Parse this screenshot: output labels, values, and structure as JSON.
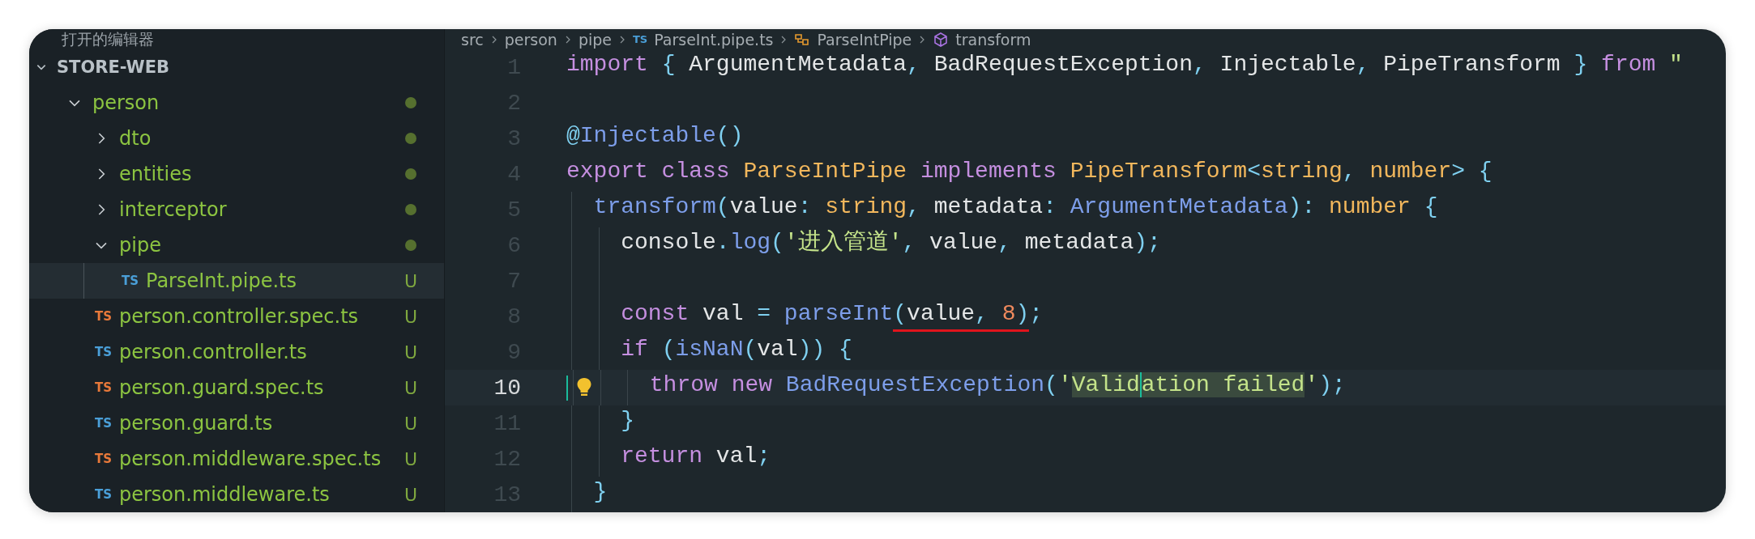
{
  "explorer": {
    "open_editors_title": "打开的编辑器",
    "root": {
      "title": "STORE-WEB"
    },
    "tree": [
      {
        "name": "person",
        "kind": "folder",
        "expanded": true,
        "selected": false,
        "modified_dot": true,
        "children": [
          {
            "name": "dto",
            "kind": "folder",
            "expanded": false,
            "selected": false,
            "modified_dot": true
          },
          {
            "name": "entities",
            "kind": "folder",
            "expanded": false,
            "selected": false,
            "modified_dot": true
          },
          {
            "name": "interceptor",
            "kind": "folder",
            "expanded": false,
            "selected": false,
            "modified_dot": true
          },
          {
            "name": "pipe",
            "kind": "folder",
            "expanded": true,
            "selected": false,
            "modified_dot": true,
            "children": [
              {
                "name": "ParseInt.pipe.ts",
                "kind": "file",
                "badge": "TS",
                "color": "#4a9fd8",
                "status": "U",
                "selected": true
              }
            ]
          },
          {
            "name": "person.controller.spec.ts",
            "kind": "file",
            "badge": "TS",
            "color": "#e8793a",
            "status": "U",
            "selected": false
          },
          {
            "name": "person.controller.ts",
            "kind": "file",
            "badge": "TS",
            "color": "#4a9fd8",
            "status": "U",
            "selected": false
          },
          {
            "name": "person.guard.spec.ts",
            "kind": "file",
            "badge": "TS",
            "color": "#e8793a",
            "status": "U",
            "selected": false
          },
          {
            "name": "person.guard.ts",
            "kind": "file",
            "badge": "TS",
            "color": "#4a9fd8",
            "status": "U",
            "selected": false
          },
          {
            "name": "person.middleware.spec.ts",
            "kind": "file",
            "badge": "TS",
            "color": "#e8793a",
            "status": "U",
            "selected": false
          },
          {
            "name": "person.middleware.ts",
            "kind": "file",
            "badge": "TS",
            "color": "#4a9fd8",
            "status": "U",
            "selected": false
          }
        ]
      }
    ]
  },
  "breadcrumb": [
    {
      "kind": "folder",
      "text": "src"
    },
    {
      "kind": "folder",
      "text": "person"
    },
    {
      "kind": "folder",
      "text": "pipe"
    },
    {
      "kind": "file",
      "badge": "TS",
      "text": "ParseInt.pipe.ts"
    },
    {
      "kind": "class",
      "text": "ParseIntPipe"
    },
    {
      "kind": "method",
      "text": "transform"
    }
  ],
  "code": [
    {
      "number": "1",
      "current": false,
      "lightbulb": false,
      "tokens": [
        {
          "kind": "kw",
          "text": "import "
        },
        {
          "kind": "punct",
          "text": "{"
        },
        {
          "kind": "plain",
          "text": " ArgumentMetadata"
        },
        {
          "kind": "punct",
          "text": ","
        },
        {
          "kind": "plain",
          "text": " BadRequestException"
        },
        {
          "kind": "punct",
          "text": ","
        },
        {
          "kind": "plain",
          "text": " Injectable"
        },
        {
          "kind": "punct",
          "text": ","
        },
        {
          "kind": "plain",
          "text": " PipeTransform "
        },
        {
          "kind": "punct",
          "text": "} "
        },
        {
          "kind": "kw",
          "text": "from "
        },
        {
          "kind": "str",
          "text": "\""
        }
      ]
    },
    {
      "number": "2",
      "current": false,
      "lightbulb": false
    },
    {
      "number": "3",
      "current": false,
      "lightbulb": false,
      "tokens": [
        {
          "kind": "punct",
          "text": "@"
        },
        {
          "kind": "fn",
          "text": "Injectable"
        },
        {
          "kind": "punct",
          "text": "()"
        }
      ]
    },
    {
      "number": "4",
      "current": false,
      "lightbulb": false,
      "tokens": [
        {
          "kind": "kw",
          "text": "export class "
        },
        {
          "kind": "type",
          "text": "ParseIntPipe "
        },
        {
          "kind": "kw",
          "text": "implements "
        },
        {
          "kind": "type",
          "text": "PipeTransform"
        },
        {
          "kind": "punct",
          "text": "<"
        },
        {
          "kind": "type",
          "text": "string"
        },
        {
          "kind": "punct",
          "text": ", "
        },
        {
          "kind": "type",
          "text": "number"
        },
        {
          "kind": "punct",
          "text": "> {"
        }
      ]
    },
    {
      "number": "5",
      "current": false,
      "lightbulb": false,
      "tokens": [
        {
          "kind": "fn",
          "text": "  transform"
        },
        {
          "kind": "punct",
          "text": "("
        },
        {
          "kind": "plain",
          "text": "value"
        },
        {
          "kind": "punct",
          "text": ": "
        },
        {
          "kind": "type",
          "text": "string"
        },
        {
          "kind": "punct",
          "text": ","
        },
        {
          "kind": "plain",
          "text": " metadata"
        },
        {
          "kind": "punct",
          "text": ": "
        },
        {
          "kind": "fn",
          "text": "ArgumentMetadata"
        },
        {
          "kind": "punct",
          "text": "): "
        },
        {
          "kind": "type",
          "text": "number "
        },
        {
          "kind": "punct",
          "text": "{"
        }
      ]
    },
    {
      "number": "6",
      "current": false,
      "lightbulb": false,
      "tokens": [
        {
          "kind": "plain",
          "text": "    console"
        },
        {
          "kind": "punct",
          "text": "."
        },
        {
          "kind": "fn",
          "text": "log"
        },
        {
          "kind": "punct",
          "text": "("
        },
        {
          "kind": "str",
          "text": "'进入管道'"
        },
        {
          "kind": "punct",
          "text": ","
        },
        {
          "kind": "plain",
          "text": " value"
        },
        {
          "kind": "punct",
          "text": ","
        },
        {
          "kind": "plain",
          "text": " metadata"
        },
        {
          "kind": "punct",
          "text": ");"
        }
      ]
    },
    {
      "number": "7",
      "current": false,
      "lightbulb": false
    },
    {
      "number": "8",
      "current": false,
      "lightbulb": false,
      "tokens": [
        {
          "kind": "kw",
          "text": "    const"
        },
        {
          "kind": "plain",
          "text": " val "
        },
        {
          "kind": "punct",
          "text": "= "
        },
        {
          "kind": "fn",
          "text": "parseInt"
        },
        {
          "kind": "punct",
          "text": "(",
          "underlined": true
        },
        {
          "kind": "plain",
          "text": "value",
          "underlined": true
        },
        {
          "kind": "punct",
          "text": ", ",
          "underlined": true
        },
        {
          "kind": "num",
          "text": "8",
          "underlined": true
        },
        {
          "kind": "punct",
          "text": ")",
          "underlined": true
        },
        {
          "kind": "punct",
          "text": ";",
          "underlined": false
        }
      ]
    },
    {
      "number": "9",
      "current": false,
      "lightbulb": false,
      "tokens": [
        {
          "kind": "kw",
          "text": "    if "
        },
        {
          "kind": "punct",
          "text": "("
        },
        {
          "kind": "fn",
          "text": "isNaN"
        },
        {
          "kind": "punct",
          "text": "("
        },
        {
          "kind": "plain",
          "text": "val"
        },
        {
          "kind": "punct",
          "text": ")) {"
        }
      ]
    },
    {
      "number": "10",
      "current": true,
      "lightbulb": true,
      "tokens": [
        {
          "kind": "kw",
          "text": "      throw new "
        },
        {
          "kind": "fn",
          "text": "BadRequestException"
        },
        {
          "kind": "punct",
          "text": "("
        },
        {
          "kind": "str",
          "text": "'"
        },
        {
          "kind": "str",
          "text": "Valid",
          "highlight": true,
          "cursor_after": true
        },
        {
          "kind": "str",
          "text": "ation failed",
          "highlight": true,
          "cursor_after": false
        },
        {
          "kind": "str",
          "text": "'",
          "highlight": false
        },
        {
          "kind": "punct",
          "text": ");"
        }
      ]
    },
    {
      "number": "11",
      "current": false,
      "lightbulb": false,
      "tokens": [
        {
          "kind": "punct",
          "text": "    }"
        }
      ]
    },
    {
      "number": "12",
      "current": false,
      "lightbulb": false,
      "tokens": [
        {
          "kind": "kw",
          "text": "    return"
        },
        {
          "kind": "plain",
          "text": " val"
        },
        {
          "kind": "punct",
          "text": ";"
        }
      ]
    },
    {
      "number": "13",
      "current": false,
      "lightbulb": false,
      "tokens": [
        {
          "kind": "punct",
          "text": "  }"
        }
      ]
    }
  ]
}
